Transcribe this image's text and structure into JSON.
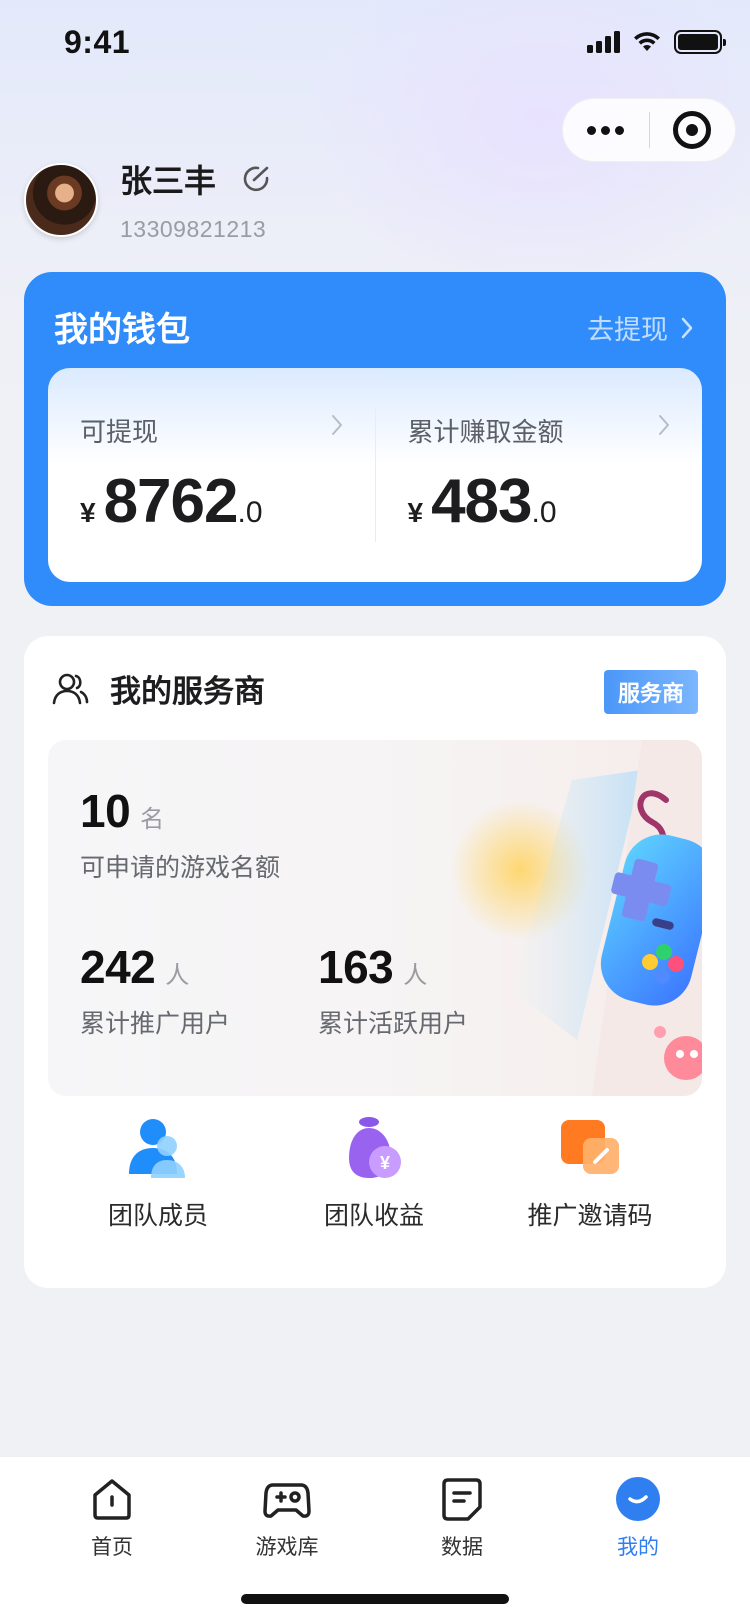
{
  "status_bar": {
    "time": "9:41"
  },
  "profile": {
    "name": "张三丰",
    "phone": "13309821213"
  },
  "wallet": {
    "title": "我的钱包",
    "withdraw_link": "去提现",
    "available": {
      "label": "可提现",
      "currency": "¥",
      "integer": "8762",
      "decimal": ".0"
    },
    "earned": {
      "label": "累计赚取金额",
      "currency": "¥",
      "integer": "483",
      "decimal": ".0"
    }
  },
  "service": {
    "title": "我的服务商",
    "badge": "服务商",
    "quota": {
      "value": "10",
      "unit": "名",
      "label": "可申请的游戏名额"
    },
    "promoted": {
      "value": "242",
      "unit": "人",
      "label": "累计推广用户"
    },
    "active": {
      "value": "163",
      "unit": "人",
      "label": "累计活跃用户"
    },
    "actions": [
      {
        "label": "团队成员",
        "icon": "team-members-icon"
      },
      {
        "label": "团队收益",
        "icon": "team-earnings-icon"
      },
      {
        "label": "推广邀请码",
        "icon": "invite-code-icon"
      }
    ]
  },
  "tabbar": {
    "tabs": [
      {
        "label": "首页",
        "icon": "home-icon"
      },
      {
        "label": "游戏库",
        "icon": "gamepad-icon"
      },
      {
        "label": "数据",
        "icon": "document-icon"
      },
      {
        "label": "我的",
        "icon": "profile-icon",
        "active": true
      }
    ]
  },
  "colors": {
    "primary": "#2f8cfa",
    "active_tab": "#2f7ff0"
  }
}
